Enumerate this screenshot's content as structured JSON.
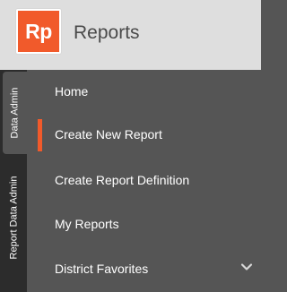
{
  "header": {
    "logo_text": "Rp",
    "title": "Reports"
  },
  "vertical_tabs": [
    {
      "label": "Data Admin",
      "active": true
    },
    {
      "label": "Report Data Admin",
      "active": false
    }
  ],
  "menu": {
    "items": [
      {
        "label": "Home",
        "selected": false
      },
      {
        "label": "Create New Report",
        "selected": true
      },
      {
        "label": "Create Report Definition",
        "selected": false
      },
      {
        "label": "My Reports",
        "selected": false
      },
      {
        "label": "District Favorites",
        "selected": false,
        "expandable": true,
        "icon": "chevron-down-icon"
      }
    ]
  },
  "colors": {
    "accent": "#f15a2b",
    "header_bg": "#dedede",
    "menu_bg": "#555555",
    "tab_rail_bg": "#2c2c2c"
  }
}
